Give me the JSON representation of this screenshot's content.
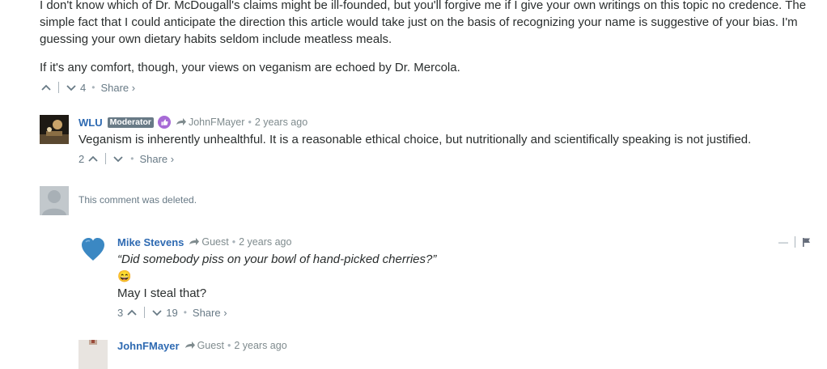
{
  "top_comment": {
    "paragraph1": "I don't know which of Dr. McDougall's claims might be ill-founded, but you'll forgive me if I give your own writings on this topic no credence. The simple fact that I could anticipate the direction this article would take just on the basis of recognizing your name is suggestive of your bias. I'm guessing your own dietary habits seldom include meatless meals.",
    "paragraph2": "If it's any comfort, though, your views on veganism are echoed by Dr. Mercola.",
    "upvotes": "",
    "downvotes": "4",
    "share_label": "Share ›"
  },
  "reply_wlu": {
    "author": "WLU",
    "badge": "Moderator",
    "reply_to": "JohnFMayer",
    "time": "2 years ago",
    "text": "Veganism is inherently unhealthful. It is a reasonable ethical choice, but nutritionally and scientifically speaking is not justified.",
    "upvotes": "2",
    "downvotes": "",
    "share_label": "Share ›"
  },
  "deleted": {
    "text": "This comment was deleted."
  },
  "reply_mike": {
    "author": "Mike Stevens",
    "reply_to": "Guest",
    "time": "2 years ago",
    "quote": "“Did somebody piss on your bowl of hand-picked cherries?”",
    "emoji": "😄",
    "text": "May I steal that?",
    "upvotes": "3",
    "downvotes": "19",
    "share_label": "Share ›",
    "collapse_label": "—"
  },
  "reply_john": {
    "author": "JohnFMayer",
    "reply_to": "Guest",
    "time": "2 years ago"
  },
  "separator_dot": "•",
  "colors": {
    "author_blue": "#2e6ab2",
    "meta_gray": "#7f8b8e",
    "heart_blue": "#3b88c3",
    "badge_gray": "#687a86",
    "like_purple": "#a76bd6"
  },
  "icons": [
    "chevron-up-icon",
    "chevron-down-icon",
    "reply-arrow-icon",
    "thumbs-up-icon",
    "heart-icon",
    "flag-icon",
    "avatar-placeholder-icon",
    "emoji-grin-icon"
  ]
}
